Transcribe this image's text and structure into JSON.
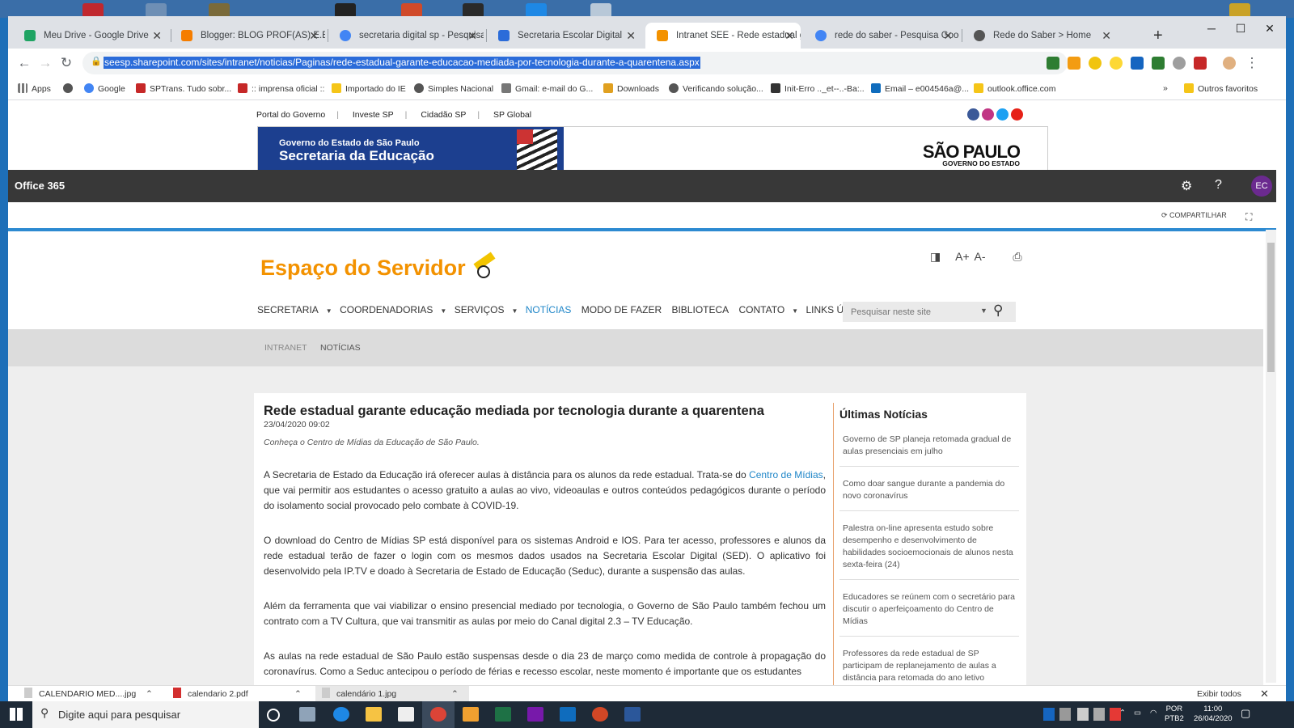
{
  "browser": {
    "tabs": [
      {
        "label": "Meu Drive - Google Drive",
        "color": "#1fa463"
      },
      {
        "label": "Blogger: BLOG PROF(AS) E.E.RAU",
        "color": "#f57d00"
      },
      {
        "label": "secretaria digital sp - Pesquisa G",
        "color": "#4285f4"
      },
      {
        "label": "Secretaria Escolar Digital",
        "color": "#2b6cd9"
      },
      {
        "label": "Intranet SEE - Rede estadual gara",
        "color": "#f39200"
      },
      {
        "label": "rede do saber - Pesquisa Google",
        "color": "#4285f4"
      },
      {
        "label": "Rede do Saber > Home",
        "color": "#555555"
      }
    ],
    "url": "seesp.sharepoint.com/sites/intranet/noticias/Paginas/rede-estadual-garante-educacao-mediada-por-tecnologia-durante-a-quarentena.aspx",
    "bookmarks": [
      "Apps",
      "Google",
      "SPTrans. Tudo sobr...",
      ":: imprensa oficial ::",
      "Importado do IE",
      "Simples Nacional",
      "Gmail: e-mail do G...",
      "Downloads",
      "Verificando solução...",
      "Init-Erro .._et--..-Ba:..",
      "Email – e004546a@...",
      "outlook.office.com"
    ],
    "other_bookmarks": "Outros favoritos",
    "more": "»"
  },
  "gov": {
    "links": [
      "Portal do Governo",
      "Investe SP",
      "Cidadão SP",
      "SP Global"
    ],
    "banner_line1": "Governo do Estado de São Paulo",
    "banner_line2": "Secretaria da Educação",
    "sp_logo1": "SÃO PAULO",
    "sp_logo2": "GOVERNO DO ESTADO"
  },
  "o365": {
    "title": "Office 365",
    "avatar": "EC",
    "settings": "⚙",
    "help": "?"
  },
  "share": "COMPARTILHAR",
  "site": {
    "logo": "Espaço do Servidor",
    "font_up": "A+",
    "font_down": "A-",
    "nav": [
      "SECRETARIA",
      "COORDENADORIAS",
      "SERVIÇOS",
      "NOTÍCIAS",
      "MODO DE FAZER",
      "BIBLIOTECA",
      "CONTATO",
      "LINKS ÚTEIS"
    ],
    "search_placeholder": "Pesquisar neste site",
    "breadcrumb": [
      "INTRANET",
      "NOTÍCIAS"
    ]
  },
  "article": {
    "title": "Rede estadual garante educação mediada por tecnologia durante a quarentena",
    "date": "23/04/2020 09:02",
    "subtitle": "Conheça o Centro de Mídias da Educação de São Paulo.",
    "p1_a": "A Secretaria de Estado da Educação irá oferecer aulas à distância para os alunos da rede estadual. Trata-se do ",
    "p1_link": "Centro de Mídias",
    "p1_b": ", que vai permitir aos estudantes o acesso gratuito a aulas ao vivo, videoaulas e outros conteúdos pedagógicos durante o período do isolamento social provocado pelo combate à COVID-19.",
    "p2": "O download do Centro de Mídias SP está disponível para os sistemas Android e IOS. Para ter acesso, professores e alunos da rede estadual terão de fazer o login com os mesmos dados usados na Secretaria Escolar Digital (SED). O aplicativo foi desenvolvido pela IP.TV e doado à Secretaria de Estado de Educação (Seduc), durante a suspensão das aulas.",
    "p3": "Além da ferramenta que vai viabilizar o ensino presencial mediado por tecnologia, o Governo de São Paulo também fechou um contrato com a TV Cultura, que vai transmitir as aulas por meio do Canal digital 2.3 – TV Educação.",
    "p4": "As aulas na rede estadual de São Paulo estão suspensas desde o dia 23 de março como medida de controle à propagação do coronavírus. Como a Seduc antecipou o período de férias e recesso escolar, neste momento é importante que os estudantes"
  },
  "sidebar": {
    "title": "Últimas Notícias",
    "items": [
      "Governo de SP planeja retomada gradual de aulas presenciais em julho",
      "Como doar sangue durante a pandemia do novo coronavírus",
      "Palestra on-line apresenta estudo sobre desempenho e desenvolvimento de habilidades socioemocionais de alunos nesta sexta-feira (24)",
      "Educadores se reúnem com o secretário para discutir o aperfeiçoamento do Centro de Mídias",
      "Professores da rede estadual de SP participam de replanejamento de aulas a distância para retomada do ano letivo"
    ]
  },
  "downloads": {
    "items": [
      "CALENDARIO MED....jpg",
      "calendario 2.pdf",
      "calendário 1.jpg"
    ],
    "show_all": "Exibir todos"
  },
  "taskbar": {
    "search": "Digite aqui para pesquisar",
    "lang1": "POR",
    "lang2": "PTB2",
    "time": "11:00",
    "date": "26/04/2020"
  }
}
